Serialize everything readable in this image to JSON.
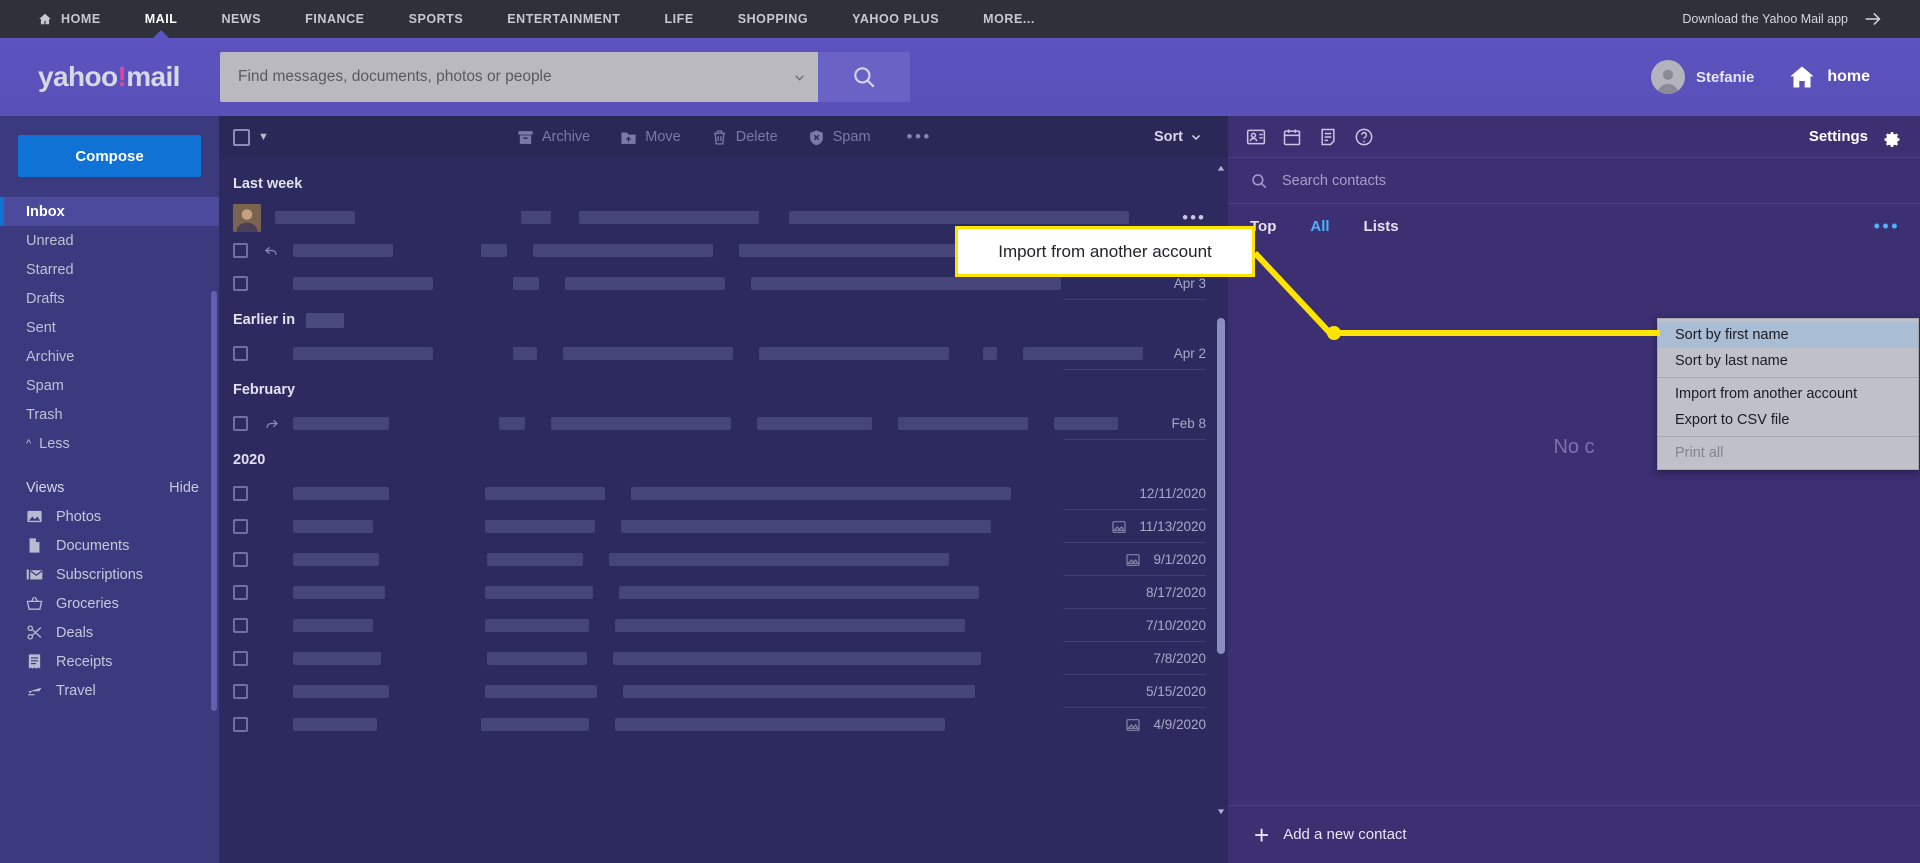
{
  "topnav": {
    "home_label": "HOME",
    "items": [
      {
        "label": "MAIL",
        "active": true
      },
      {
        "label": "NEWS",
        "active": false
      },
      {
        "label": "FINANCE",
        "active": false
      },
      {
        "label": "SPORTS",
        "active": false
      },
      {
        "label": "ENTERTAINMENT",
        "active": false
      },
      {
        "label": "LIFE",
        "active": false
      },
      {
        "label": "SHOPPING",
        "active": false
      },
      {
        "label": "YAHOO PLUS",
        "active": false
      },
      {
        "label": "MORE...",
        "active": false
      }
    ],
    "download_label": "Download the Yahoo Mail app"
  },
  "header": {
    "logo_text": "yahoo",
    "logo_bang": "!",
    "logo_suffix": "mail",
    "search_placeholder": "Find messages, documents, photos or people",
    "account_name": "Stefanie",
    "home_label": "home"
  },
  "sidebar": {
    "compose_label": "Compose",
    "folders": [
      {
        "label": "Inbox",
        "active": true
      },
      {
        "label": "Unread",
        "active": false
      },
      {
        "label": "Starred",
        "active": false
      },
      {
        "label": "Drafts",
        "active": false
      },
      {
        "label": "Sent",
        "active": false
      },
      {
        "label": "Archive",
        "active": false
      },
      {
        "label": "Spam",
        "active": false
      },
      {
        "label": "Trash",
        "active": false
      }
    ],
    "less_label": "Less",
    "views_label": "Views",
    "hide_label": "Hide",
    "views": [
      {
        "label": "Photos",
        "icon": "photos-icon"
      },
      {
        "label": "Documents",
        "icon": "documents-icon"
      },
      {
        "label": "Subscriptions",
        "icon": "subscriptions-icon"
      },
      {
        "label": "Groceries",
        "icon": "groceries-icon"
      },
      {
        "label": "Deals",
        "icon": "deals-icon"
      },
      {
        "label": "Receipts",
        "icon": "receipts-icon"
      },
      {
        "label": "Travel",
        "icon": "travel-icon"
      }
    ]
  },
  "toolbar": {
    "archive_label": "Archive",
    "move_label": "Move",
    "delete_label": "Delete",
    "spam_label": "Spam",
    "more_label": "•••",
    "sort_label": "Sort"
  },
  "maillist": {
    "groups": [
      {
        "title": "Last week",
        "title_redacted": false,
        "rows": [
          {
            "date": "",
            "thumb": true,
            "icon": "",
            "has_image": false
          },
          {
            "date": "",
            "thumb": false,
            "icon": "reply-icon",
            "has_image": false
          },
          {
            "date": "Apr 3",
            "thumb": false,
            "icon": "",
            "has_image": false
          }
        ]
      },
      {
        "title": "Earlier in",
        "title_redacted": true,
        "rows": [
          {
            "date": "Apr 2",
            "thumb": false,
            "icon": "",
            "has_image": false
          }
        ]
      },
      {
        "title": "February",
        "title_redacted": false,
        "rows": [
          {
            "date": "Feb 8",
            "thumb": false,
            "icon": "forward-icon",
            "has_image": false
          }
        ]
      },
      {
        "title": "2020",
        "title_redacted": false,
        "rows": [
          {
            "date": "12/11/2020",
            "thumb": false,
            "icon": "",
            "has_image": false
          },
          {
            "date": "11/13/2020",
            "thumb": false,
            "icon": "",
            "has_image": true
          },
          {
            "date": "9/1/2020",
            "thumb": false,
            "icon": "",
            "has_image": true
          },
          {
            "date": "8/17/2020",
            "thumb": false,
            "icon": "",
            "has_image": false
          },
          {
            "date": "7/10/2020",
            "thumb": false,
            "icon": "",
            "has_image": false
          },
          {
            "date": "7/8/2020",
            "thumb": false,
            "icon": "",
            "has_image": false
          },
          {
            "date": "5/15/2020",
            "thumb": false,
            "icon": "",
            "has_image": false
          },
          {
            "date": "4/9/2020",
            "thumb": false,
            "icon": "",
            "has_image": true
          }
        ]
      }
    ]
  },
  "contacts": {
    "settings_label": "Settings",
    "search_placeholder": "Search contacts",
    "tabs": [
      {
        "label": "Top",
        "active": false
      },
      {
        "label": "All",
        "active": true
      },
      {
        "label": "Lists",
        "active": false
      }
    ],
    "tab_more": "•••",
    "empty_text": "No c",
    "add_contact_label": "Add a new contact"
  },
  "dropdown": {
    "items": [
      {
        "label": "Sort by first name",
        "state": "highlight"
      },
      {
        "label": "Sort by last name",
        "state": "normal"
      },
      {
        "label": "SEP",
        "state": "separator"
      },
      {
        "label": "Import from another account",
        "state": "normal"
      },
      {
        "label": "Export to CSV file",
        "state": "normal"
      },
      {
        "label": "SEP",
        "state": "separator"
      },
      {
        "label": "Print all",
        "state": "disabled"
      }
    ]
  },
  "callout": {
    "text": "Import from another account",
    "border_color": "#ffe400"
  }
}
